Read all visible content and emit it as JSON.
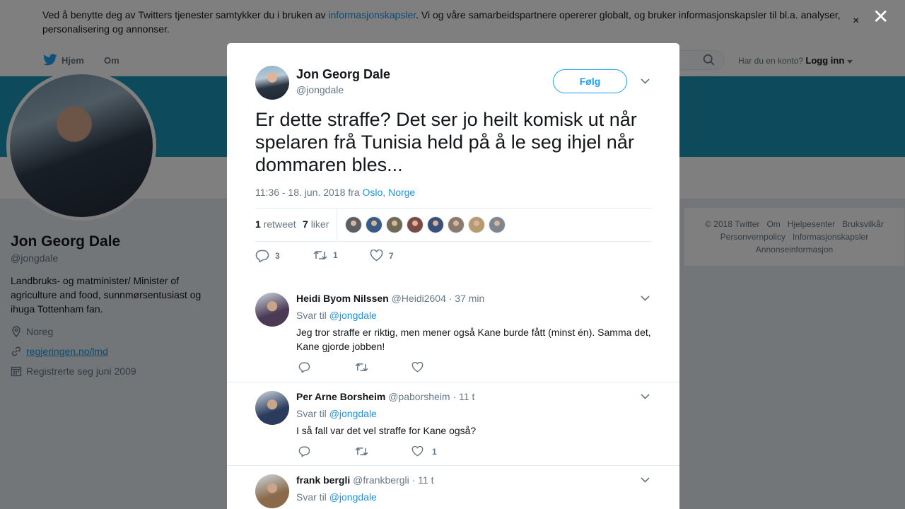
{
  "cookie": {
    "text_before": "Ved å benytte deg av Twitters tjenester samtykker du i bruken av ",
    "link": "informasjonskapsler",
    "text_after": ". Vi og våre samarbeidspartnere opererer globalt, og bruker informasjonskapsler til bl.a. analyser, personalisering og annonser.",
    "close": "×"
  },
  "nav": {
    "home": "Hjem",
    "about": "Om",
    "login_prompt": "Har du en konto?",
    "login": "Logg inn"
  },
  "profile": {
    "name": "Jon Georg Dale",
    "handle": "@jongdale",
    "bio": "Landbruks- og matminister/ Minister of agriculture and food, sunnmørsentusiast og ihuga Tottenham fan.",
    "location": "Noreg",
    "website": "regjeringen.no/lmd",
    "joined": "Registrerte seg juni 2009"
  },
  "footer": {
    "items": [
      "© 2018 Twitter",
      "Om",
      "Hjelpesenter",
      "Bruksvilkår",
      "Personvernpolicy",
      "Informasjonskapsler",
      "Annonseinformasjon"
    ]
  },
  "overlay_close": "✕",
  "tweet": {
    "name": "Jon Georg Dale",
    "handle": "@jongdale",
    "follow": "Følg",
    "text": "Er dette straffe? Det ser jo heilt komisk ut når spelaren frå Tunisia held på å le seg ihjel når dommaren bles...",
    "time": "11:36 - 18. jun. 2018 fra ",
    "place": "Oslo, Norge",
    "retweets": "1",
    "retweets_label": "retweet",
    "likes": "7",
    "likes_label": "liker",
    "reply_count": "3",
    "retweet_count": "1",
    "like_count": "7",
    "liker_colors": [
      "#5b5f63",
      "#3a5a86",
      "#6d6a55",
      "#7c4a44",
      "#3b4f7a",
      "#8a7a6e",
      "#b89a70",
      "#7d8590"
    ]
  },
  "replies": [
    {
      "name": "Heidi Byom Nilssen",
      "handle": "@Heidi2604",
      "time": "· 37 min",
      "reply_to_prefix": "Svar til ",
      "reply_to": "@jongdale",
      "text": "Jeg tror straffe er riktig, men mener også Kane burde fått (minst én). Samma det, Kane gjorde jobben!",
      "like_count": "",
      "avatar_color": "#4a3a55"
    },
    {
      "name": "Per Arne Borsheim",
      "handle": "@paborsheim",
      "time": "· 11 t",
      "reply_to_prefix": "Svar til ",
      "reply_to": "@jongdale",
      "text": "I så fall var det vel straffe for Kane også?",
      "like_count": "1",
      "avatar_color": "#2a3b5e"
    },
    {
      "name": "frank bergli",
      "handle": "@frankbergli",
      "time": "· 11 t",
      "reply_to_prefix": "Svar til ",
      "reply_to": "@jongdale",
      "avatar_color": "#8a6a4a"
    }
  ]
}
